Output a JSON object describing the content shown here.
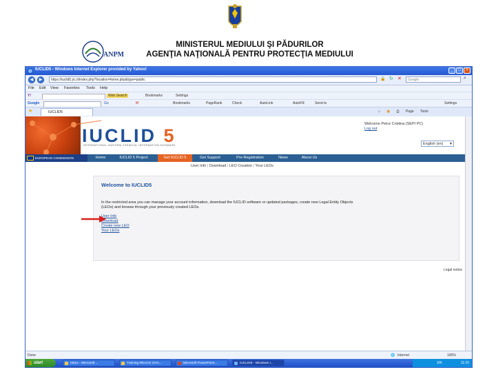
{
  "slide": {
    "title_line1": "MINISTERUL MEDIULUI ŞI PĂDURILOR",
    "title_line2": "AGENŢIA NAŢIONALĂ PENTRU PROTECŢIA MEDIULUI",
    "logo_text": "ANPM"
  },
  "browser": {
    "window_title": "IUCLID5 - Windows Internet Explorer provided by Yahoo!",
    "url": "https://iuclid5.jrc.it/index.php?location=home.php&type=public",
    "search_placeholder": "Google",
    "menu": [
      "File",
      "Edit",
      "View",
      "Favorites",
      "Tools",
      "Help"
    ],
    "yahoo_toolbar": {
      "search_label": "Web Search",
      "items": [
        "Bookmarks",
        "Settings"
      ]
    },
    "google_toolbar": {
      "label": "Google",
      "items": [
        "Bookmarks",
        "PageRank",
        "Check",
        "AutoLink",
        "AutoFill",
        "Send to"
      ],
      "settings": "Settings"
    },
    "tab_label": "IUCLID5",
    "tab_tools": [
      "Page",
      "Tools"
    ],
    "status_left": "Done",
    "status_zone": "Internet",
    "zoom": "100%"
  },
  "page": {
    "logo_main": "IUCLID",
    "logo_num": "5",
    "logo_sub": "INTERNATIONAL UNIFORM CHEMICAL INFORMATION DATABASE",
    "welcome_user": "Welcome Pelce Cristina (SEPI PC)",
    "logout": "Log out",
    "language": "English (en)",
    "eu_label": "EUROPEAN COMMISSION",
    "nav": [
      "Home",
      "IUCLID 5 Project",
      "Get IUCLID 5",
      "Get Support",
      "Pre-Registration",
      "News",
      "About Us"
    ],
    "subnav": [
      "User Info",
      "Download",
      "LEO Creation",
      "Your LEOs"
    ],
    "panel_title": "Welcome to IUCLID5",
    "panel_text": "In the restricted area you can manage your account information, download the IUCLID software or updated packages, create new Legal Entity Objects (LEOs) and browse through your previously created LEOs.",
    "links": [
      "User Info",
      "Download",
      "Create new LEO",
      "Your LEOs"
    ],
    "legal_notice": "Legal notice"
  },
  "taskbar": {
    "start": "start",
    "items": [
      "Inbox - Microsoft ...",
      "Training REACH CHA...",
      "Microsoft PowerPoint...",
      "IUCLID5 - Windows I..."
    ],
    "tray_lang": "EN",
    "clock": "11:15"
  },
  "colors": {
    "iuclid_blue": "#1d4f9a",
    "iuclid_orange": "#e56323",
    "nav_bar": "#2b5f93",
    "arrow": "#d81e1e"
  }
}
